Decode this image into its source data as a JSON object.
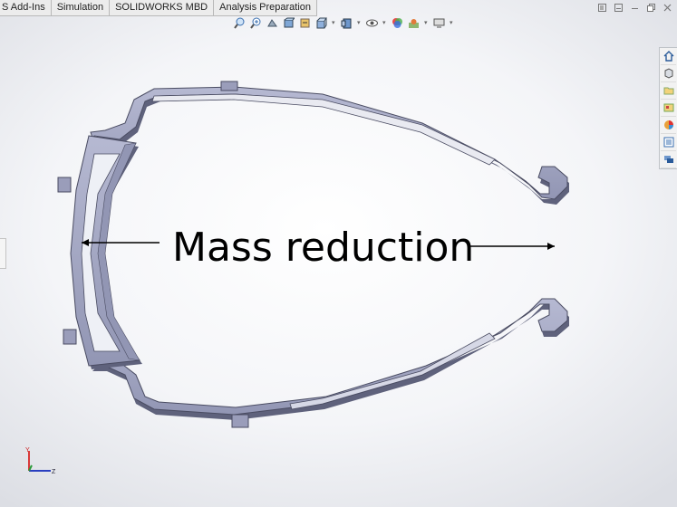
{
  "tabs": [
    {
      "label": "S Add-Ins"
    },
    {
      "label": "Simulation"
    },
    {
      "label": "SOLIDWORKS MBD"
    },
    {
      "label": "Analysis Preparation"
    }
  ],
  "window_controls": [
    "restore-icon",
    "minimize-icon",
    "maximize-icon",
    "close-icon"
  ],
  "heads_up_toolbar": [
    "zoom-to-fit-icon",
    "zoom-to-area-icon",
    "previous-view-icon",
    "section-view-icon",
    "dynamic-annotation-icon",
    "view-orientation-icon",
    "display-style-icon",
    "hide-show-icon",
    "edit-appearance-icon",
    "apply-scene-icon",
    "view-settings-icon"
  ],
  "task_pane": [
    "home-icon",
    "design-library-icon",
    "file-explorer-icon",
    "view-palette-icon",
    "appearances-icon",
    "custom-properties-icon",
    "forum-icon"
  ],
  "annotation": {
    "text": "Mass reduction"
  },
  "triad": {
    "y_label": "Y",
    "z_label": "Z"
  },
  "colors": {
    "part_face": "#a3a6c2",
    "part_side": "#63667f",
    "axis_y": "#d93a3a",
    "axis_z": "#2a3fc0",
    "axis_x": "#2b9a3a"
  }
}
